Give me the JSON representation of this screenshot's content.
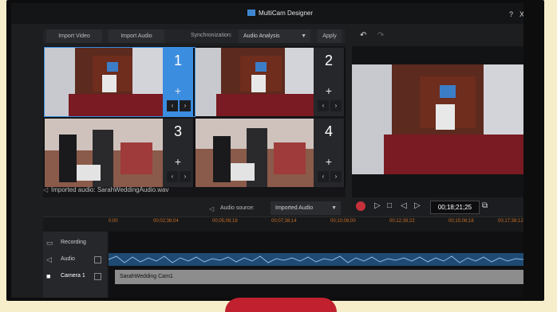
{
  "window": {
    "title": "MultiCam Designer",
    "help": "?",
    "close": "X"
  },
  "toolbar": {
    "import_video": "Import Video",
    "import_audio": "Import Audio",
    "sync_label": "Synchronization:",
    "sync_value": "Audio Analysis",
    "apply": "Apply"
  },
  "cameras": [
    {
      "number": "1",
      "active": true
    },
    {
      "number": "2",
      "active": false
    },
    {
      "number": "3",
      "active": false
    },
    {
      "number": "4",
      "active": false
    }
  ],
  "audio_info": "Imported audio: SarahWeddingAudio.wav",
  "audio_source": {
    "label": "Audio source:",
    "value": "Imported Audio"
  },
  "timecode": "00;18;21;25",
  "ruler_ticks": [
    "0;00",
    "00;02;38;04",
    "00;05;08;18",
    "00;07;38;14",
    "00;10;08;00",
    "00;12;38;22",
    "00;15;08;18",
    "00;17;38;12"
  ],
  "tracks": {
    "recording": "Recording",
    "audio": "Audio",
    "camera1": "Camera 1"
  },
  "clip_name": "SarahWedding Cam1",
  "colors": {
    "accent": "#3b8de0",
    "record": "#c5313a",
    "ruler_text": "#c66e28",
    "bezel_stand": "#c1212f",
    "background": "#f6eecb"
  }
}
